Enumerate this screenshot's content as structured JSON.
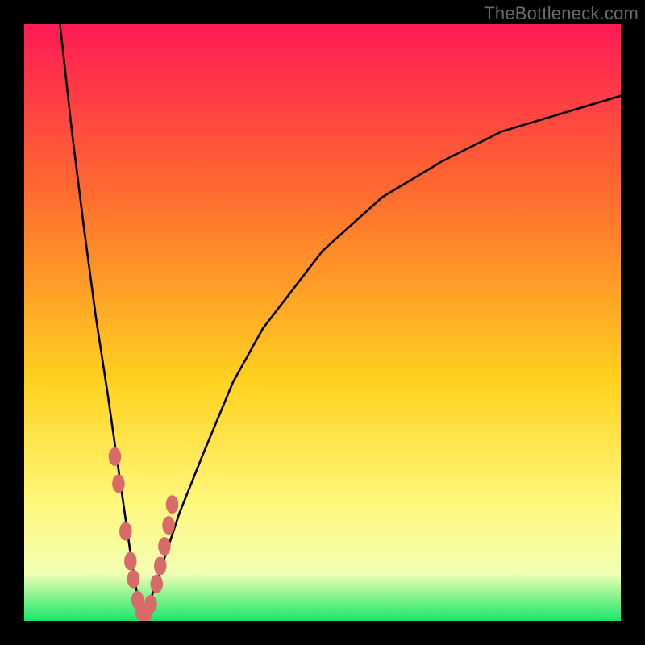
{
  "watermark": "TheBottleneck.com",
  "palette": {
    "top": "#ff1a55",
    "upper_mid": "#ff6a2f",
    "mid": "#ffd21f",
    "lower_mid": "#fff77a",
    "pale": "#f2ffb3",
    "bottom": "#19e66b",
    "curve": "#000000",
    "marker": "#d96a6a"
  },
  "chart_data": {
    "type": "line",
    "title": "",
    "xlabel": "",
    "ylabel": "",
    "xlim": [
      0,
      100
    ],
    "ylim": [
      0,
      100
    ],
    "notch_x": 20,
    "series": [
      {
        "name": "left-branch",
        "x": [
          6,
          8,
          10,
          12,
          14,
          16,
          17,
          18,
          19,
          20
        ],
        "y": [
          100,
          82,
          66,
          51,
          38,
          24,
          17,
          10,
          4,
          0
        ]
      },
      {
        "name": "right-branch",
        "x": [
          20,
          22,
          24,
          26,
          30,
          35,
          40,
          50,
          60,
          70,
          80,
          90,
          100
        ],
        "y": [
          0,
          6,
          12,
          18,
          28,
          40,
          49,
          62,
          71,
          77,
          82,
          85,
          88
        ]
      }
    ],
    "markers": {
      "name": "highlighted-points",
      "x": [
        15.2,
        15.8,
        17.0,
        17.8,
        18.3,
        19.0,
        19.7,
        20.4,
        21.2,
        22.2,
        22.8,
        23.5,
        24.2,
        24.8
      ],
      "y": [
        27.5,
        23.0,
        15.0,
        10.0,
        7.0,
        3.5,
        1.5,
        1.3,
        2.8,
        6.2,
        9.2,
        12.5,
        16.0,
        19.5
      ]
    }
  }
}
